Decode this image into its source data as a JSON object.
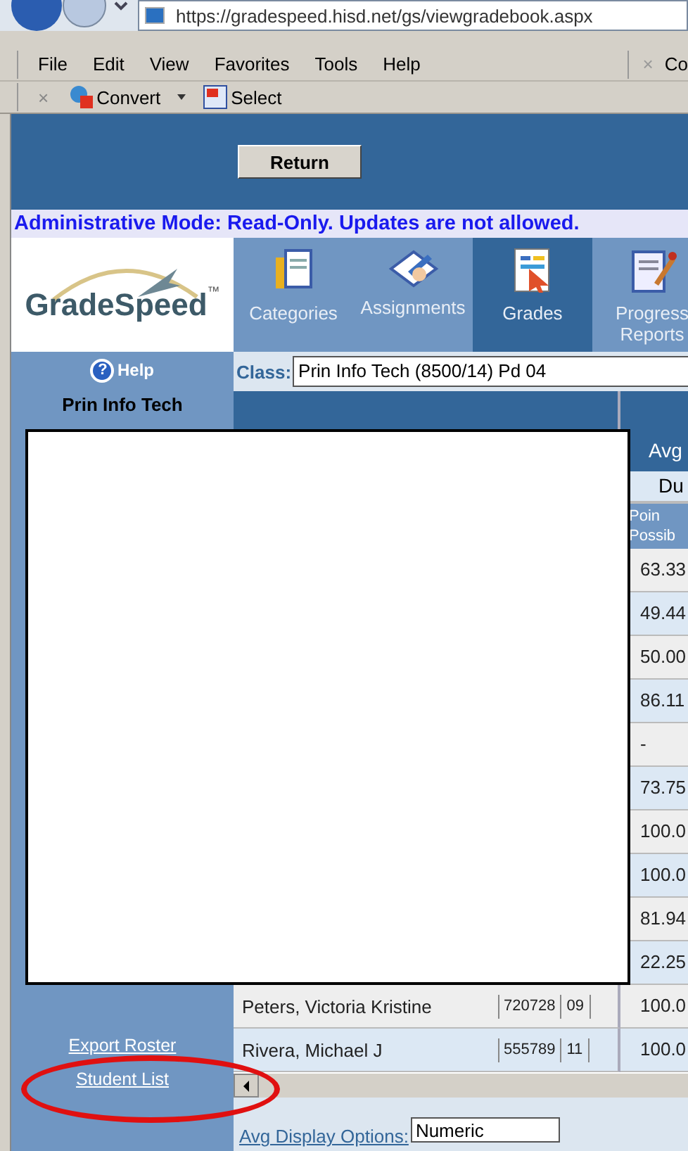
{
  "browser": {
    "url": "https://gradespeed.hisd.net/gs/viewgradebook.aspx",
    "menu": [
      "File",
      "Edit",
      "View",
      "Favorites",
      "Tools",
      "Help"
    ],
    "menu_right_close": "×",
    "menu_right": "Co",
    "toolbar": [
      {
        "kind": "close",
        "label": "×"
      },
      {
        "kind": "convert",
        "label": "Convert"
      },
      {
        "kind": "select",
        "label": "Select"
      }
    ]
  },
  "return_button": "Return",
  "notice": "Administrative Mode: Read-Only. Updates are not allowed.",
  "logo": {
    "name": "GradeSpeed",
    "mark": "™"
  },
  "tabs": [
    {
      "label": "Categories",
      "kind": "categories",
      "selected": false
    },
    {
      "label": "Assignments",
      "kind": "assignments",
      "selected": false
    },
    {
      "label": "Grades",
      "kind": "grades",
      "selected": true
    },
    {
      "label": "Progress Reports",
      "kind": "progress",
      "selected": false
    }
  ],
  "sidebar": {
    "help_icon": "?",
    "help": "Help",
    "course": "Prin Info Tech",
    "links": [
      "Export Roster",
      "Student List"
    ]
  },
  "class_field": {
    "label": "Class:",
    "value": "Prin Info Tech (8500/14) Pd 04"
  },
  "table": {
    "avg_header": "Avg",
    "due": "Du",
    "points": [
      "Poin",
      "Possib"
    ],
    "rows": [
      {
        "avg": "63.33"
      },
      {
        "avg": "49.44"
      },
      {
        "avg": "50.00"
      },
      {
        "avg": "86.11"
      },
      {
        "avg": "-"
      },
      {
        "avg": "73.75"
      },
      {
        "avg": "100.0"
      },
      {
        "avg": "100.0"
      },
      {
        "avg": "81.94"
      },
      {
        "avg": "22.25"
      },
      {
        "name": "Peters, Victoria Kristine",
        "id": "720728",
        "grade": "09",
        "avg": "100.0"
      },
      {
        "name": "Rivera, Michael J",
        "id": "555789",
        "grade": "11",
        "avg": "100.0"
      }
    ]
  },
  "avg_display": {
    "label": "Avg Display Options:",
    "value": "Numeric"
  }
}
